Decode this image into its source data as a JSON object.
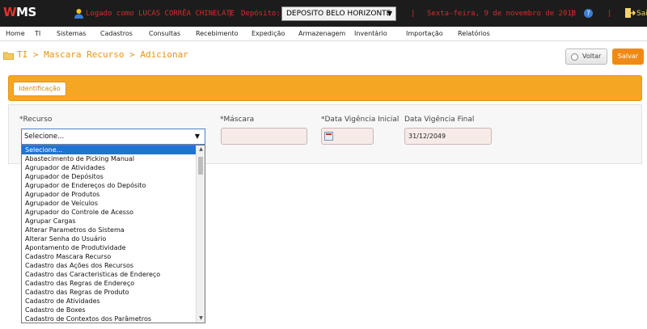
{
  "header": {
    "logo": {
      "w": "W",
      "rest": "MS"
    },
    "logged_in": "Logado como LUCAS CORRÊA CHINELATE",
    "sep1": "|",
    "deposit_label": "Depósito:",
    "deposit_value": "DEPOSITO BELO HORIZONTE",
    "sep2": "|",
    "date": "Sexta-feira, 9 de novembro de 2018",
    "sep3": "|",
    "sep4": "|",
    "exit_label": "Sair",
    "colors": {
      "bar": "#1c1c1c",
      "accent": "#d42d2d"
    }
  },
  "menu": [
    "Home",
    "TI",
    "Sistemas",
    "Cadastros",
    "Consultas",
    "Recebimento",
    "Expedição",
    "Armazenagem",
    "Inventário",
    "Importação",
    "Relatórios"
  ],
  "breadcrumb": "TI > Mascara Recurso > Adicionar",
  "buttons": {
    "back": "Voltar",
    "save": "Salvar"
  },
  "tabs": [
    "Identificação"
  ],
  "form": {
    "recurso_label": "*Recurso",
    "recurso_value": "Selecione...",
    "mascara_label": "*Máscara",
    "mascara_value": "",
    "vig_ini_label": "*Data Vigência Inicial",
    "vig_ini_value": "",
    "vig_fim_label": "Data Vigência Final",
    "vig_fim_value": "31/12/2049"
  },
  "dropdown_options": [
    "Selecione...",
    "Abastecimento de Picking Manual",
    "Agrupador de Atividades",
    "Agrupador de Depósitos",
    "Agrupador de Endereços do Depósito",
    "Agrupador de Produtos",
    "Agrupador de Veículos",
    "Agrupador do Controle de Acesso",
    "Agrupar Cargas",
    "Alterar Parametros do Sistema",
    "Alterar Senha do Usuário",
    "Apontamento de Produtividade",
    "Cadastro Mascara Recurso",
    "Cadastro das Ações dos Recursos",
    "Cadastro das Caracteristicas de Endereço",
    "Cadastro das Regras de Endereço",
    "Cadastro das Regras de Produto",
    "Cadastro de Atividades",
    "Cadastro de Boxes",
    "Cadastro de Contextos dos Parâmetros"
  ]
}
